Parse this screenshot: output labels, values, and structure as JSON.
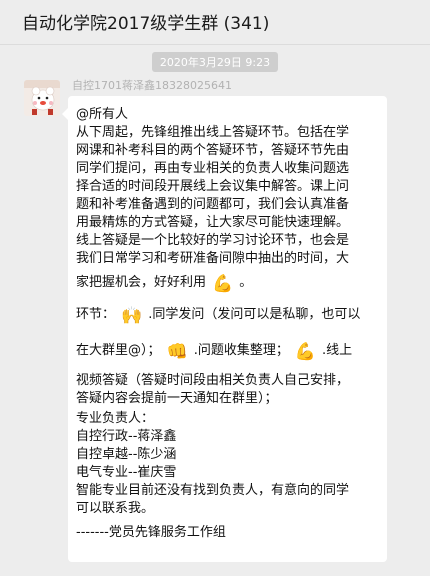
{
  "header": {
    "title": "自动化学院2017级学生群 (341)"
  },
  "timestamp": "2020年3月29日 9:23",
  "message": {
    "sender": "自控1701蒋泽鑫18328025641",
    "lines": [
      "@所有人",
      "从下周起，先锋组推出线上答疑环节。包括在学",
      "网课和补考科目的两个答疑环节，答疑环节先由",
      "同学们提问，再由专业相关的负责人收集问题选",
      "择合适的时间段开展线上会议集中解答。课上问",
      "题和补考准备遇到的问题都可，我们会认真准备",
      "用最精炼的方式答疑，让大家尽可能快速理解。",
      "线上答疑是一个比较好的学习讨论环节，也会是",
      "我们日常学习和考研准备间隙中抽出的时间，大",
      "家把握机会，好好利用",
      "。",
      "环节：",
      ".同学发问（发问可以是私聊，也可以",
      "在大群里@）；",
      ".问题收集整理；",
      ".线上",
      "视频答疑（答疑时间段由相关负责人自己安排，",
      "答疑内容会提前一天通知在群里）；",
      "专业负责人：",
      "自控行政--蒋泽鑫",
      "自控卓越--陈少涵",
      "电气专业--崔庆雪",
      "智能专业目前还没有找到负责人，有意向的同学",
      "可以联系我。",
      "-------党员先锋服务工作组"
    ],
    "emojis": {
      "muscle": "💪",
      "raised_hands": "🙌",
      "fist": "👊"
    }
  }
}
